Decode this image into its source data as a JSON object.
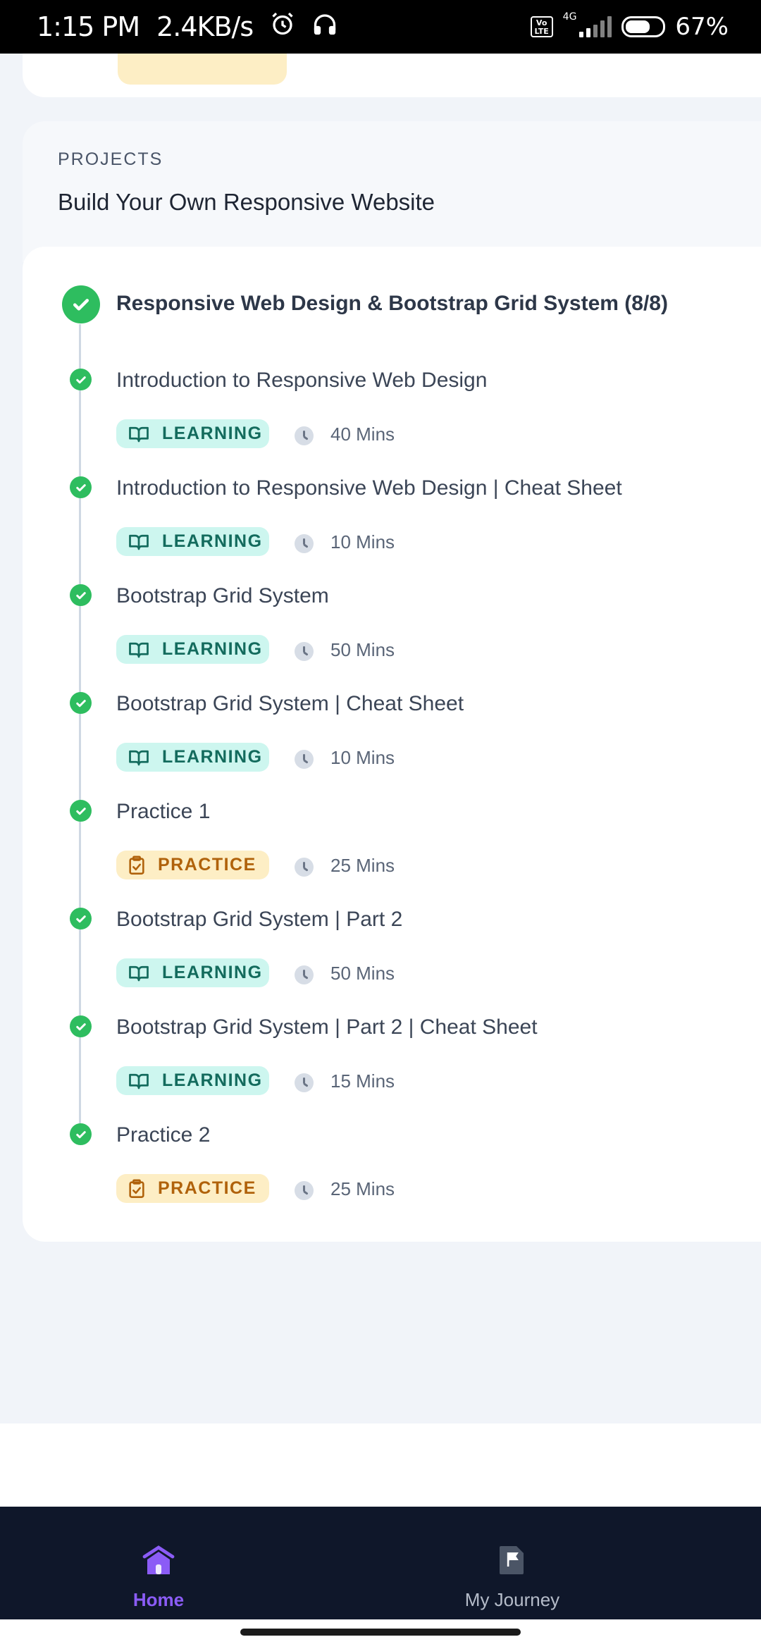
{
  "status_bar": {
    "time": "1:15 PM",
    "speed": "2.4KB/s",
    "network": "4G",
    "volte": "Vo LTE",
    "battery": "67%",
    "battery_level": 0.67
  },
  "project": {
    "kicker": "PROJECTS",
    "title": "Build Your Own Responsive Website"
  },
  "module": {
    "title": "Responsive Web Design & Bootstrap Grid System (8/8)"
  },
  "items": [
    {
      "name": "Introduction to Responsive Web Design",
      "type": "LEARNING",
      "duration": "40 Mins"
    },
    {
      "name": "Introduction to Responsive Web Design | Cheat Sheet",
      "type": "LEARNING",
      "duration": "10 Mins"
    },
    {
      "name": "Bootstrap Grid System",
      "type": "LEARNING",
      "duration": "50 Mins"
    },
    {
      "name": "Bootstrap Grid System | Cheat Sheet",
      "type": "LEARNING",
      "duration": "10 Mins"
    },
    {
      "name": "Practice 1",
      "type": "PRACTICE",
      "duration": "25 Mins"
    },
    {
      "name": "Bootstrap Grid System | Part 2",
      "type": "LEARNING",
      "duration": "50 Mins"
    },
    {
      "name": "Bootstrap Grid System | Part 2 | Cheat Sheet",
      "type": "LEARNING",
      "duration": "15 Mins"
    },
    {
      "name": "Practice 2",
      "type": "PRACTICE",
      "duration": "25 Mins"
    }
  ],
  "nav": {
    "home": "Home",
    "journey": "My Journey"
  },
  "colors": {
    "complete_green": "#2ebd5f",
    "learning_bg": "#cdf6ef",
    "learning_text": "#136b5d",
    "practice_bg": "#fdeec5",
    "practice_text": "#b0620b",
    "nav_bg": "#0f172a",
    "nav_active": "#8b5cf6"
  }
}
